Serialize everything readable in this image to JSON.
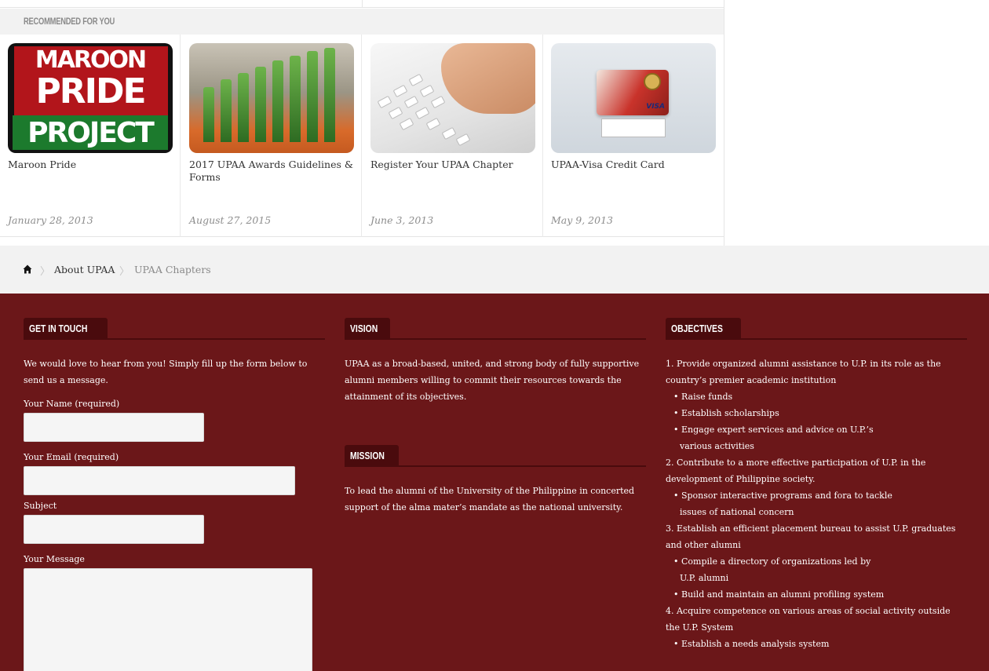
{
  "recommended": {
    "header": "Recommended for you",
    "cards": [
      {
        "title": "Maroon Pride",
        "date": "January 28, 2013",
        "thumb_text": [
          "MAROON",
          "PRIDE",
          "PROJECT"
        ]
      },
      {
        "title": "2017 UPAA Awards Guidelines & Forms",
        "date": "August 27, 2015"
      },
      {
        "title": "Register Your UPAA Chapter",
        "date": "June 3, 2013"
      },
      {
        "title": "UPAA-Visa Credit Card",
        "date": "May 9, 2013",
        "thumb_text": "VISA"
      }
    ]
  },
  "breadcrumb": {
    "home_icon": "home-icon",
    "items": [
      "About UPAA",
      "UPAA Chapters"
    ],
    "separator": "〉"
  },
  "footer": {
    "bg_color": "#6b1719",
    "accent_color": "#4a0b0d",
    "contact": {
      "heading": "Get in Touch",
      "intro": "We would love to hear from you! Simply fill up the form below to send us a message.",
      "name_label": "Your Name (required)",
      "email_label": "Your Email (required)",
      "subject_label": "Subject",
      "message_label": "Your Message"
    },
    "vision": {
      "heading": "Vision",
      "text": "UPAA as a broad-based, united, and strong body of fully supportive alumni members willing to commit their resources towards the attainment of its objectives."
    },
    "mission": {
      "heading": "Mission",
      "text": "To lead the alumni of the University of the Philippine in concerted support of the alma mater’s mandate as the national university."
    },
    "objectives": {
      "heading": "Objectives",
      "lines": [
        {
          "kind": "main",
          "text": "1. Provide organized alumni assistance to U.P. in its role as the country’s premier academic institution"
        },
        {
          "kind": "sub",
          "text": "• Raise funds"
        },
        {
          "kind": "sub",
          "text": "• Establish scholarships"
        },
        {
          "kind": "sub",
          "text": "• Engage expert services and advice on U.P.’s"
        },
        {
          "kind": "cont",
          "text": "various activities"
        },
        {
          "kind": "main",
          "text": "2. Contribute to a more effective participation of U.P. in the development of Philippine society."
        },
        {
          "kind": "sub",
          "text": "• Sponsor interactive programs and fora to tackle"
        },
        {
          "kind": "cont",
          "text": "issues of national concern"
        },
        {
          "kind": "main",
          "text": "3. Establish an efficient placement bureau to assist U.P. graduates and other alumni"
        },
        {
          "kind": "sub",
          "text": "• Compile a directory of organizations led by"
        },
        {
          "kind": "cont",
          "text": "U.P. alumni"
        },
        {
          "kind": "sub",
          "text": "• Build and maintain an alumni profiling system"
        },
        {
          "kind": "main",
          "text": "4. Acquire competence on various areas of social activity outside the U.P. System"
        },
        {
          "kind": "sub",
          "text": "• Establish a needs analysis system"
        }
      ]
    }
  }
}
